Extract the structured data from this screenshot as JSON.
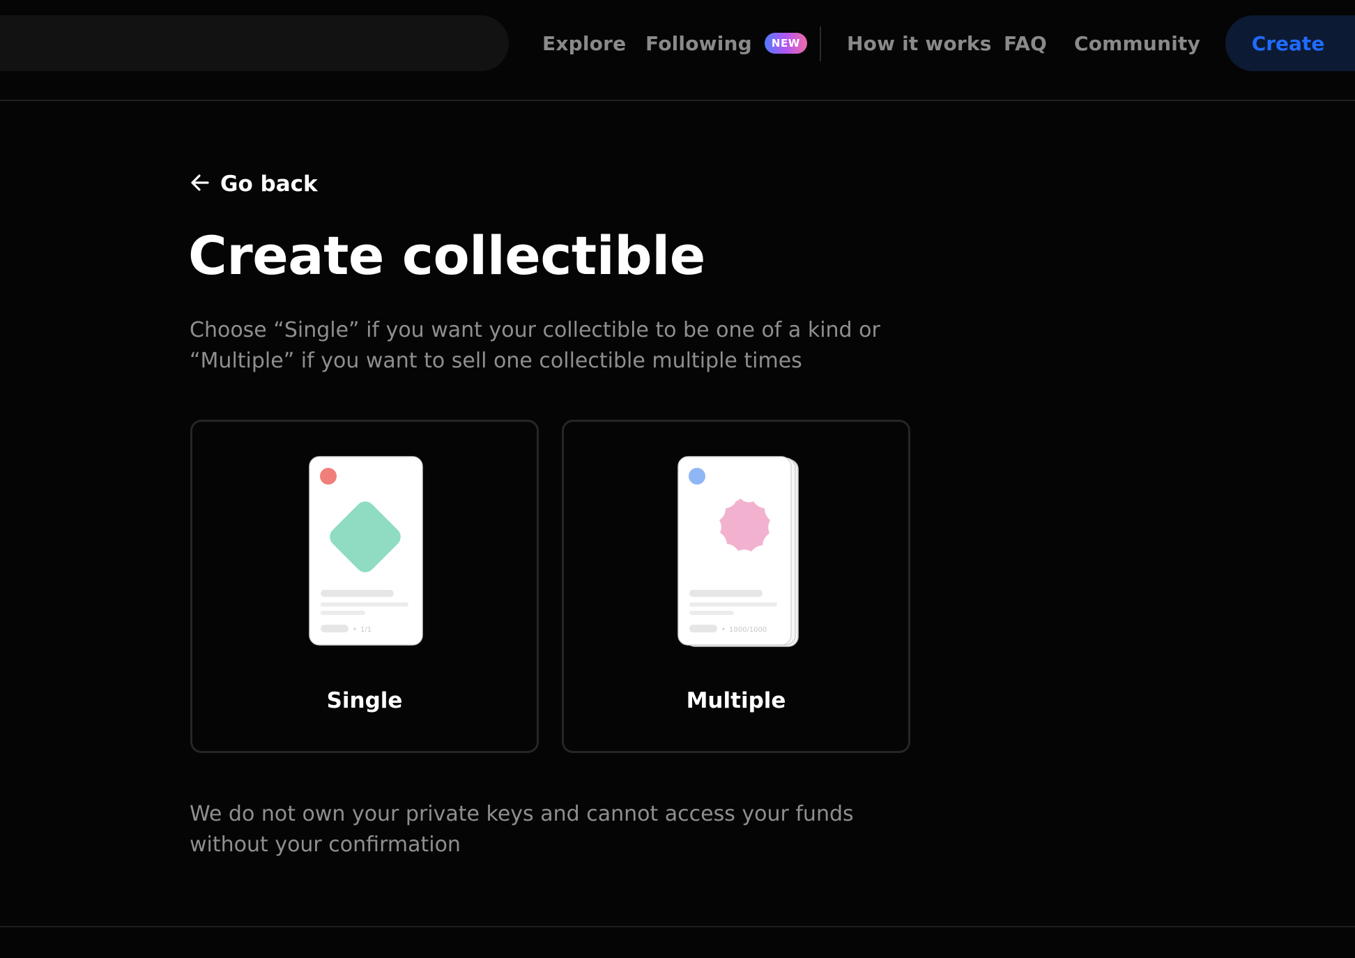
{
  "header": {
    "nav": {
      "explore": "Explore",
      "following": "Following",
      "following_badge": "NEW",
      "how_it_works": "How it works",
      "faq": "FAQ",
      "community": "Community"
    },
    "create_label": "Create"
  },
  "main": {
    "back_label": "Go back",
    "title": "Create collectible",
    "description": "Choose “Single” if you want your collectible to be one of a kind or “Multiple” if you want to sell one collectible multiple times",
    "options": [
      {
        "label": "Single",
        "edition": "1/1"
      },
      {
        "label": "Multiple",
        "edition": "1000/1000"
      }
    ],
    "footer_note": "We do not own your private keys and cannot access your funds without your confirmation"
  },
  "colors": {
    "background": "#050505",
    "accent": "#1f6bff",
    "single_dot": "#f07f7a",
    "single_shape": "#8fdcc2",
    "multiple_dot": "#8fb6f5",
    "multiple_shape": "#f2b2cf"
  },
  "icons": [
    "arrow-left-icon"
  ]
}
